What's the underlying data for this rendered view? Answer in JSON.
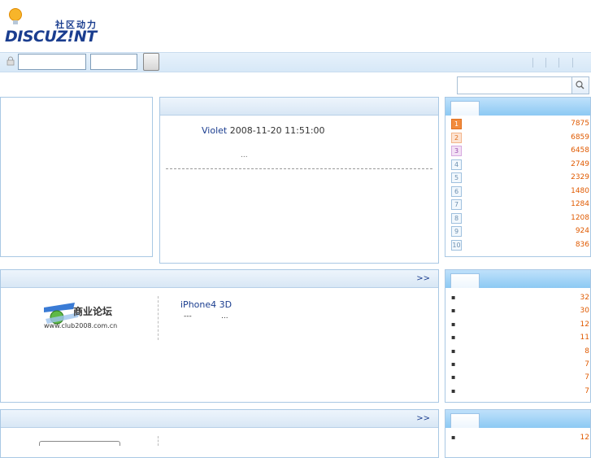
{
  "header": {
    "logo_cn": "社区动力",
    "logo_text": "DISCUZ!NT"
  },
  "login": {
    "username_value": "",
    "password_value": ""
  },
  "search": {
    "value": ""
  },
  "featured_post": {
    "author": "Violet",
    "datetime": "2008-11-20 11:51:00",
    "excerpt": "..."
  },
  "section_more_label": ">>",
  "commercial": {
    "logo_line1": "商业论坛",
    "logo_line2": "www.club2008.com.cn",
    "article_title": "iPhone4  3D",
    "article_line2a": "---",
    "article_line2b": "..."
  },
  "rankings": [
    {
      "rank": "1",
      "value": "7875"
    },
    {
      "rank": "2",
      "value": "6859"
    },
    {
      "rank": "3",
      "value": "6458"
    },
    {
      "rank": "4",
      "value": "2749"
    },
    {
      "rank": "5",
      "value": "2329"
    },
    {
      "rank": "6",
      "value": "1480"
    },
    {
      "rank": "7",
      "value": "1284"
    },
    {
      "rank": "8",
      "value": "1208"
    },
    {
      "rank": "9",
      "value": "924"
    },
    {
      "rank": "10",
      "value": "836"
    }
  ],
  "list2": [
    {
      "bullet": "▪",
      "value": "32"
    },
    {
      "bullet": "▪",
      "value": "30"
    },
    {
      "bullet": "▪",
      "value": "12"
    },
    {
      "bullet": "▪",
      "value": "11"
    },
    {
      "bullet": "▪",
      "value": "8"
    },
    {
      "bullet": "▪",
      "value": "7"
    },
    {
      "bullet": "▪",
      "value": "7"
    },
    {
      "bullet": "▪",
      "value": "7"
    }
  ],
  "list3": [
    {
      "bullet": "▪",
      "value": "12"
    }
  ],
  "colors": {
    "accent": "#1a3d8f",
    "rank_value": "#e05a00",
    "header_blue": "#8cc9f3"
  }
}
